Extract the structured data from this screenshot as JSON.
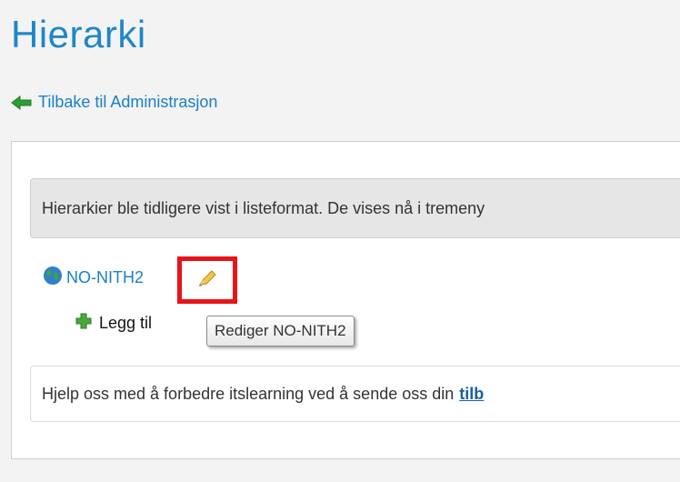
{
  "page": {
    "title": "Hierarki",
    "back_link": "Tilbake til Administrasjon"
  },
  "info": {
    "text": "Hierarkier ble tidligere vist i listeformat. De vises nå i tremeny"
  },
  "tree": {
    "root_label": "NO-NITH2",
    "edit_tooltip": "Rediger NO-NITH2",
    "add_label": "Legg til"
  },
  "feedback": {
    "text": "Hjelp oss med å forbedre itslearning ved å sende oss din",
    "link": "tilb"
  },
  "colors": {
    "accent": "#1f86c8",
    "link": "#1a80c4",
    "highlight": "#e8141a"
  },
  "icons": [
    "back-arrow-icon",
    "globe-icon",
    "pencil-icon",
    "plus-icon"
  ]
}
